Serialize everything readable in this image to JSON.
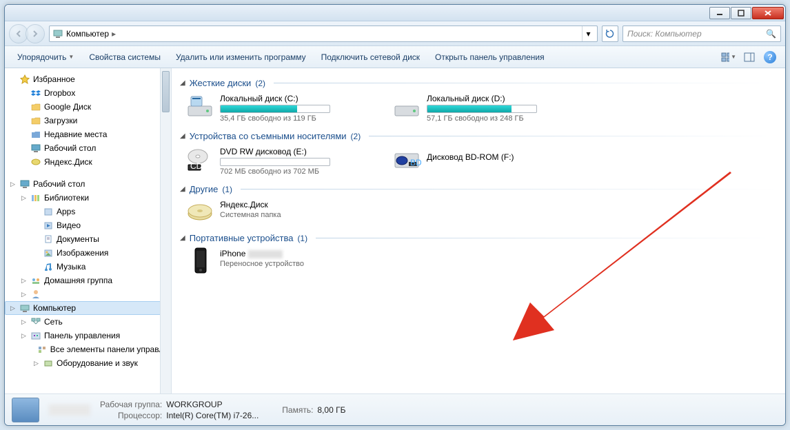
{
  "addressbar": {
    "crumb": "Компьютер",
    "search_placeholder": "Поиск: Компьютер"
  },
  "toolbar": {
    "organize": "Упорядочить",
    "properties": "Свойства системы",
    "uninstall": "Удалить или изменить программу",
    "map_drive": "Подключить сетевой диск",
    "control_panel": "Открыть панель управления"
  },
  "sidebar": {
    "favorites": "Избранное",
    "fav_items": [
      {
        "label": "Dropbox"
      },
      {
        "label": "Google Диск"
      },
      {
        "label": "Загрузки"
      },
      {
        "label": "Недавние места"
      },
      {
        "label": "Рабочий стол"
      },
      {
        "label": "Яндекс.Диск"
      }
    ],
    "desktop": "Рабочий стол",
    "libraries": "Библиотеки",
    "lib_items": [
      {
        "label": "Apps"
      },
      {
        "label": "Видео"
      },
      {
        "label": "Документы"
      },
      {
        "label": "Изображения"
      },
      {
        "label": "Музыка"
      }
    ],
    "homegroup": "Домашняя группа",
    "blurred_user": "",
    "computer": "Компьютер",
    "network": "Сеть",
    "control_panel": "Панель управления",
    "cp_items": [
      {
        "label": "Все элементы панели управле"
      },
      {
        "label": "Оборудование и звук"
      }
    ]
  },
  "groups": {
    "hdd": {
      "title": "Жесткие диски",
      "count": "(2)"
    },
    "removable": {
      "title": "Устройства со съемными носителями",
      "count": "(2)"
    },
    "other": {
      "title": "Другие",
      "count": "(1)"
    },
    "portable": {
      "title": "Портативные устройства",
      "count": "(1)"
    }
  },
  "drives": {
    "c": {
      "name": "Локальный диск (C:)",
      "free": "35,4 ГБ свободно из 119 ГБ",
      "fill_pct": 70
    },
    "d": {
      "name": "Локальный диск (D:)",
      "free": "57,1 ГБ свободно из 248 ГБ",
      "fill_pct": 77
    },
    "e": {
      "name": "DVD RW дисковод (E:)",
      "free": "702 МБ свободно из 702 МБ",
      "fill_pct": 0
    },
    "f": {
      "name": "Дисковод BD-ROM (F:)",
      "free": ""
    },
    "yadisk": {
      "name": "Яндекс.Диск",
      "sub": "Системная папка"
    },
    "iphone": {
      "name": "iPhone",
      "sub": "Переносное устройство"
    }
  },
  "status": {
    "workgroup_label": "Рабочая группа:",
    "workgroup_val": "WORKGROUP",
    "cpu_label": "Процессор:",
    "cpu_val": "Intel(R) Core(TM) i7-26...",
    "mem_label": "Память:",
    "mem_val": "8,00 ГБ"
  }
}
